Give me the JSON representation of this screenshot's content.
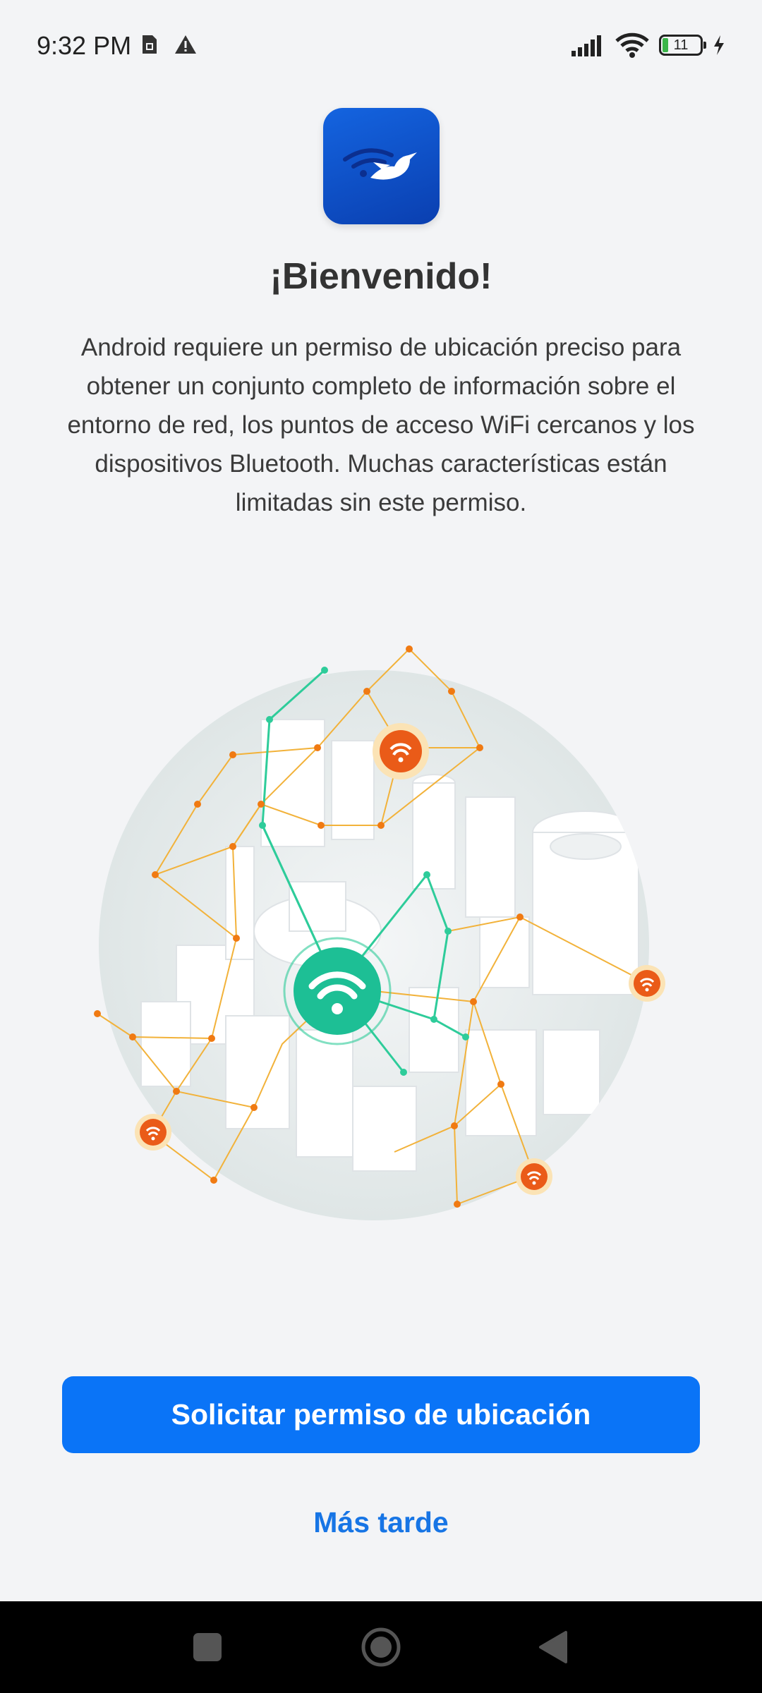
{
  "status_bar": {
    "time": "9:32 PM",
    "battery_level": "11",
    "icons": [
      "sim-icon",
      "alert-icon",
      "signal-icon",
      "wifi-icon",
      "battery-icon",
      "charging-icon"
    ]
  },
  "app": {
    "icon": "wifi-bird-logo-icon",
    "brand_color": "#0a4fc8"
  },
  "welcome": {
    "title": "¡Bienvenido!",
    "description": "Android requiere un permiso de ubicación preciso para obtener un conjunto completo de información sobre el entorno de red, los puntos de acceso WiFi cercanos y los dispositivos Bluetooth. Muchas características están limitadas sin este permiso."
  },
  "illustration": {
    "icon": "city-network-illustration",
    "hub_color": "#1dbf95",
    "node_color": "#f07a12"
  },
  "actions": {
    "request_label": "Solicitar permiso de ubicación",
    "request_color": "#0a74f7",
    "later_label": "Más tarde",
    "later_color": "#1775e5"
  },
  "nav_bar": {
    "icons": [
      "recents-icon",
      "home-icon",
      "back-icon"
    ]
  }
}
